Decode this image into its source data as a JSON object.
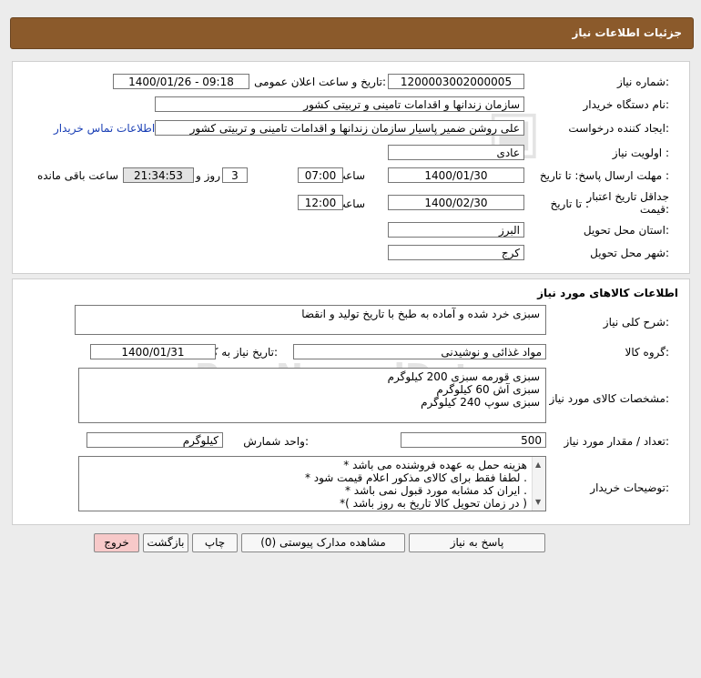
{
  "header": {
    "title": "جزئیات اطلاعات نیاز"
  },
  "details": {
    "need_number_label": "شماره نیاز:",
    "need_number": "1200003002000005",
    "announce_label": "تاریخ و ساعت اعلان عمومی:",
    "announce_value": "1400/01/26 - 09:18",
    "buyer_org_label": "نام دستگاه خریدار:",
    "buyer_org": "سازمان زندانها و اقدامات تامینی و تربیتی کشور",
    "creator_label": "ایجاد کننده درخواست:",
    "creator": "علی روشن ضمیر پاسیار سازمان زندانها و اقدامات تامینی و تربیتی کشور",
    "contact_link": "اطلاعات تماس خریدار",
    "priority_label": "اولویت نیاز :",
    "priority": "عادی",
    "deadline_label": "مهلت ارسال پاسخ: تا تاریخ :",
    "deadline_date": "1400/01/30",
    "time_label": "ساعت",
    "deadline_time": "07:00",
    "remaining_days": "3",
    "days_label": "روز و",
    "remaining_time": "21:34:53",
    "remaining_label": "ساعت باقی مانده",
    "validity_label_1": "جداقل تاریخ اعتبار",
    "validity_label_2": "قیمت:",
    "validity_to_label": "تا تاریخ :",
    "validity_date": "1400/02/30",
    "validity_time": "12:00",
    "province_label": "استان محل تحویل:",
    "province": "البرز",
    "city_label": "شهر محل تحویل:",
    "city": "کرج"
  },
  "goods": {
    "section_title": "اطلاعات کالاهای مورد نیاز",
    "desc_label": "شرح کلی نیاز:",
    "description": "سبزی خرد شده و آماده به طبخ با تاریخ تولید و انقضا",
    "group_label": "گروه کالا:",
    "group": "مواد غذائی و نوشیدنی",
    "need_date_label": "تاریخ نیاز به کالا:",
    "need_date": "1400/01/31",
    "specs_label": "مشخصات کالای مورد نیاز:",
    "specs": [
      "سبزی قورمه سبزی 200 کیلوگرم",
      "سبزی آش 60 کیلوگرم",
      "سبزی سوپ 240 کیلوگرم"
    ],
    "qty_label": "تعداد / مقدار مورد نیاز:",
    "quantity": "500",
    "unit_label": "واحد شمارش:",
    "unit": "کیلوگرم",
    "notes_label": "توضیحات خریدار:",
    "notes": [
      "هزینه حمل به عهده فروشنده می باشد *",
      ". لطفا فقط برای کالای مذکور اعلام قیمت شود *",
      ". ایران کد مشابه مورد قبول نمی باشد *",
      "( در زمان تحویل کالا تاریخ به روز باشد )*"
    ]
  },
  "buttons": {
    "reply": "پاسخ به نیاز",
    "attachments": "مشاهده مدارک پیوستی (0)",
    "print": "چاپ",
    "back": "بازگشت",
    "exit": "خروج"
  },
  "colors": {
    "header_bg": "#8b5a2b",
    "link": "#1a3fb5",
    "exit_bg": "#f7c9c9"
  }
}
